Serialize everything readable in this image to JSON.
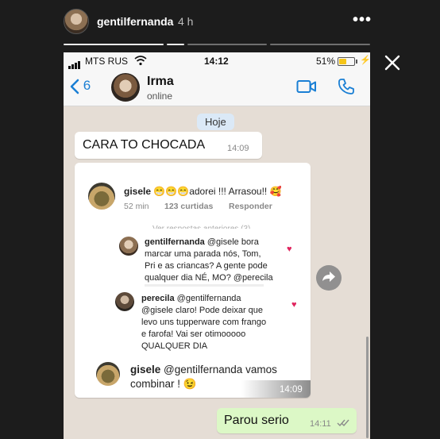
{
  "story": {
    "username": "gentilfernanda",
    "time_ago": "4 h",
    "more_label": "•••"
  },
  "status_bar": {
    "carrier": "MTS RUS",
    "time": "14:12",
    "battery": "51%",
    "battery_level": 0.51
  },
  "chat_header": {
    "back_count": "6",
    "contact_name": "Irma",
    "contact_status": "online"
  },
  "chat": {
    "day_label": "Hoje",
    "messages": [
      {
        "text": "CARA TO CHOCADA",
        "time": "14:09"
      },
      {
        "text": "Parou serio",
        "time": "14:11"
      }
    ],
    "screenshot_card": {
      "time": "14:09",
      "top_comment": {
        "user": "gisele",
        "text": "😁😁😁adorei !!! Arrasou!! 🥰",
        "age": "52 min",
        "likes": "123 curtidas",
        "reply": "Responder",
        "view_more": "Ver respostas anteriores (3)"
      },
      "replies": [
        {
          "user": "gentilfernanda",
          "lines": [
            "@gisele bora",
            "marcar uma parada nós, Tom,",
            "Pri e as criancas? A gente pode",
            "qualquer dia NÉ, MO? @perecila"
          ]
        },
        {
          "user": "perecila",
          "lines": [
            "@gentilfernanda",
            "@gisele claro! Pode deixar que",
            "levo uns tupperware com frango",
            "e farofa! Vai ser otimooooo",
            "QUALQUER DIA"
          ]
        }
      ],
      "bottom_comment": {
        "user": "gisele",
        "lines": [
          "@gentilfernanda vamos",
          "combinar ! 😉"
        ]
      }
    }
  }
}
